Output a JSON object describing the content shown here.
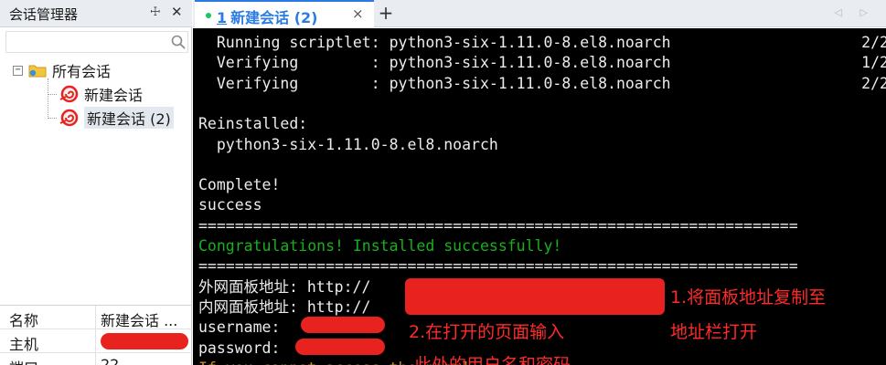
{
  "left_panel": {
    "title": "会话管理器",
    "pin_glyph": "☩",
    "close_glyph": "✕",
    "search_placeholder": "",
    "tree": {
      "expand_glyph": "−",
      "root_label": "所有会话",
      "items": [
        {
          "label": "新建会话"
        },
        {
          "label": "新建会话 (2)"
        }
      ]
    },
    "properties": [
      {
        "key": "名称",
        "value": "新建会话 ..."
      },
      {
        "key": "主机",
        "value": ""
      },
      {
        "key": "端口",
        "value": "22"
      }
    ]
  },
  "tabs": {
    "active": {
      "index": "1",
      "title": "新建会话 (2)"
    },
    "close_glyph": "×",
    "new_tab_glyph": "+",
    "nav_glyphs": "◁ ▷"
  },
  "terminal": {
    "lines": [
      {
        "text": "  Running scriptlet: python3-six-1.11.0-8.el8.noarch                     2/2",
        "color": "white"
      },
      {
        "text": "  Verifying        : python3-six-1.11.0-8.el8.noarch                     1/2",
        "color": "white"
      },
      {
        "text": "  Verifying        : python3-six-1.11.0-8.el8.noarch                     2/2",
        "color": "white"
      },
      {
        "text": "",
        "color": "white"
      },
      {
        "text": "Reinstalled:",
        "color": "white"
      },
      {
        "text": "  python3-six-1.11.0-8.el8.noarch",
        "color": "white"
      },
      {
        "text": "",
        "color": "white"
      },
      {
        "text": "Complete!",
        "color": "white"
      },
      {
        "text": "success",
        "color": "white"
      },
      {
        "text": "==================================================================",
        "color": "white"
      },
      {
        "text": "Congratulations! Installed successfully!",
        "color": "green"
      },
      {
        "text": "==================================================================",
        "color": "white"
      },
      {
        "text": "外网面板地址: http://",
        "color": "white"
      },
      {
        "text": "内网面板地址: http://",
        "color": "white"
      },
      {
        "text": "username:",
        "color": "white"
      },
      {
        "text": "password:",
        "color": "white"
      },
      {
        "text": "If you cannot access the panel,",
        "color": "orange"
      }
    ]
  },
  "annotations": [
    {
      "text": "1.将面板地址复制至"
    },
    {
      "text": "地址栏打开"
    },
    {
      "text": "2.在打开的页面输入"
    },
    {
      "text": "此处的用户名和密码"
    }
  ],
  "colors": {
    "accent": "#2a7be4",
    "terminal_bg": "#000000",
    "terminal_text": "#ececec",
    "success_green": "#18b01f",
    "warning_orange": "#c08a1c",
    "annotation_red": "#ff2a2a",
    "redaction_red": "#e8231f"
  }
}
